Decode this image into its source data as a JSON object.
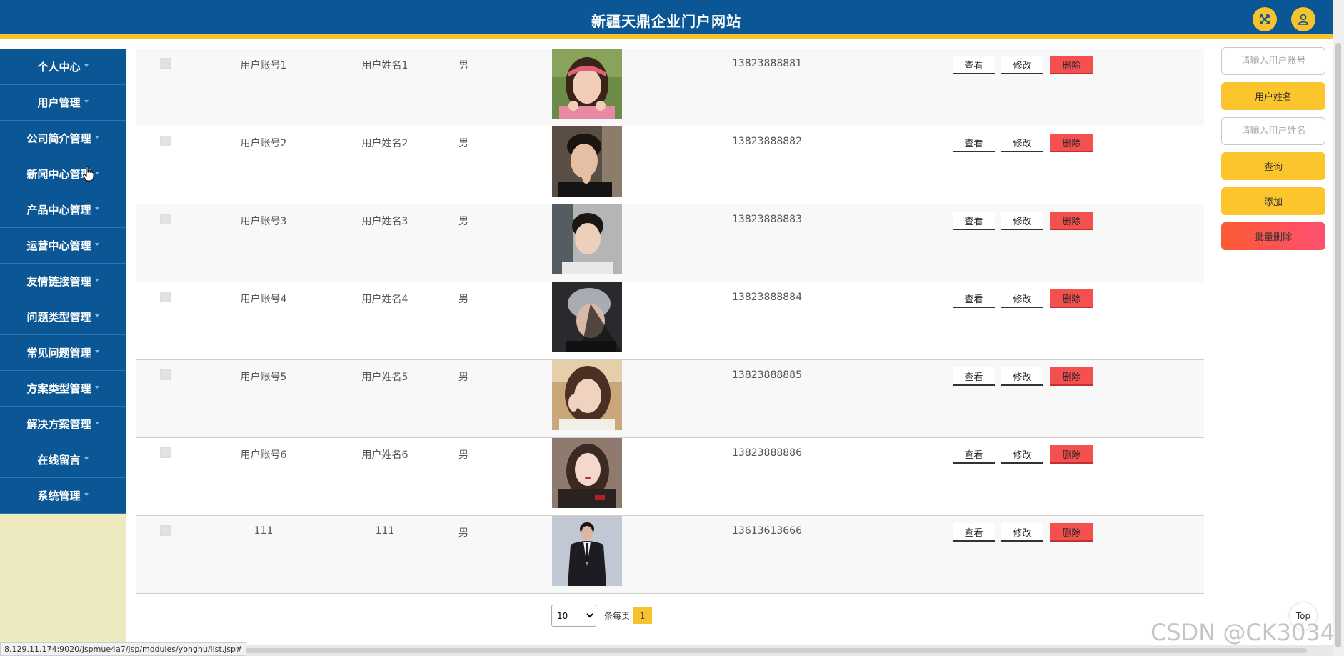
{
  "header": {
    "title": "新疆天鼎企业门户网站",
    "accent_color": "#f6c32c",
    "bg_color": "#0b5796",
    "fullscreen_icon": "expand-arrows-icon",
    "user_icon": "user-icon"
  },
  "sidebar": {
    "items": [
      {
        "label": "个人中心"
      },
      {
        "label": "用户管理"
      },
      {
        "label": "公司简介管理"
      },
      {
        "label": "新闻中心管理"
      },
      {
        "label": "产品中心管理"
      },
      {
        "label": "运营中心管理"
      },
      {
        "label": "友情链接管理"
      },
      {
        "label": "问题类型管理"
      },
      {
        "label": "常见问题管理"
      },
      {
        "label": "方案类型管理"
      },
      {
        "label": "解决方案管理"
      },
      {
        "label": "在线留言"
      },
      {
        "label": "系统管理"
      }
    ]
  },
  "table": {
    "rows": [
      {
        "account": "用户账号1",
        "name": "用户姓名1",
        "sex": "男",
        "phone": "13823888881",
        "photo": "woman-with-headband-photo"
      },
      {
        "account": "用户账号2",
        "name": "用户姓名2",
        "sex": "男",
        "phone": "13823888882",
        "photo": "young-man-photo"
      },
      {
        "account": "用户账号3",
        "name": "用户姓名3",
        "sex": "男",
        "phone": "13823888883",
        "photo": "young-man-car-photo"
      },
      {
        "account": "用户账号4",
        "name": "用户姓名4",
        "sex": "男",
        "phone": "13823888884",
        "photo": "man-grey-hair-photo"
      },
      {
        "account": "用户账号5",
        "name": "用户姓名5",
        "sex": "男",
        "phone": "13823888885",
        "photo": "woman-hand-on-face-photo"
      },
      {
        "account": "用户账号6",
        "name": "用户姓名6",
        "sex": "男",
        "phone": "13823888886",
        "photo": "woman-dark-coat-photo"
      },
      {
        "account": "111",
        "name": "111",
        "sex": "男",
        "phone": "13613613666",
        "photo": "man-in-suit-photo"
      }
    ],
    "actions": {
      "view": "查看",
      "edit": "修改",
      "delete": "删除"
    }
  },
  "pagination": {
    "page_size": "10",
    "per_page_label": "条每页",
    "current_page": "1"
  },
  "search_panel": {
    "account_placeholder": "请输入用户账号",
    "name_label": "用户姓名",
    "name_placeholder": "请输入用户姓名",
    "query_label": "查询",
    "add_label": "添加",
    "batch_delete_label": "批量删除"
  },
  "status_url": "8.129.11.174:9020/jspmue4a7/jsp/modules/yonghu/list.jsp#",
  "top_button": "Top",
  "watermark": "CSDN @CK3034"
}
